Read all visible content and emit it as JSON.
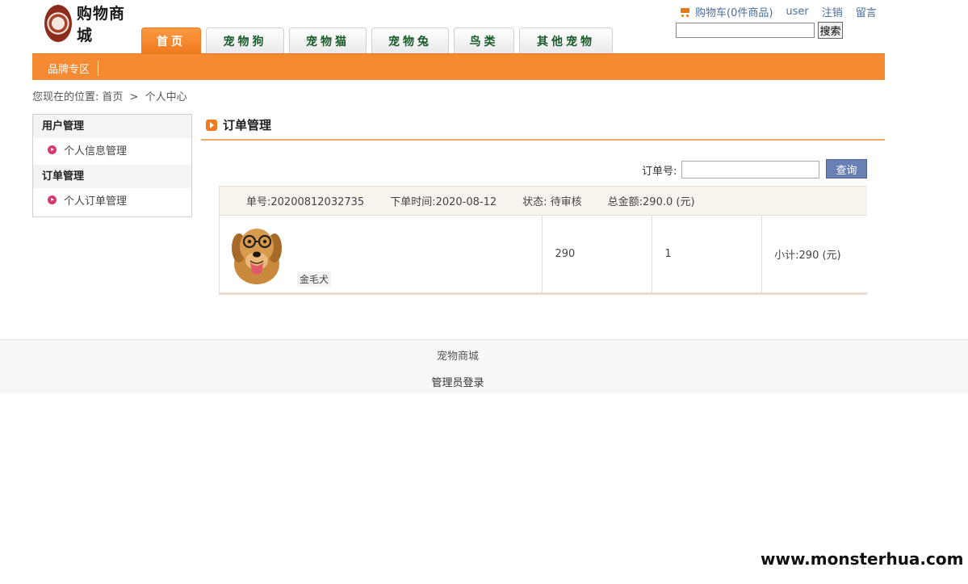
{
  "header": {
    "logo_text": "购物商城",
    "nav_tabs": [
      {
        "label": "首页",
        "active": true
      },
      {
        "label": "宠物狗",
        "active": false
      },
      {
        "label": "宠物猫",
        "active": false
      },
      {
        "label": "宠物兔",
        "active": false
      },
      {
        "label": "鸟类",
        "active": false
      },
      {
        "label": "其他宠物",
        "active": false
      }
    ],
    "cart_label": "购物车(0件商品)",
    "user_label": "user",
    "logout_label": "注销",
    "message_label": "留言",
    "search_value": "",
    "search_button": "搜索"
  },
  "brand_bar": {
    "brand_link": "品牌专区"
  },
  "breadcrumb": {
    "prefix": "您现在的位置:",
    "home": "首页",
    "separator": ">",
    "current": "个人中心"
  },
  "sidebar": {
    "sections": [
      {
        "title": "用户管理",
        "item": "个人信息管理"
      },
      {
        "title": "订单管理",
        "item": "个人订单管理"
      }
    ]
  },
  "main": {
    "title": "订单管理",
    "order_search_label": "订单号:",
    "order_search_value": "",
    "query_button": "查询",
    "order": {
      "order_no": "单号:20200812032735",
      "order_time": "下单时间:2020-08-12",
      "status": "状态: 待审核",
      "total": "总金额:290.0 (元)",
      "product_name": "金毛犬",
      "price": "290",
      "quantity": "1",
      "subtotal": "小计:290 (元)"
    }
  },
  "footer": {
    "site_name": "宠物商城",
    "admin_login": "管理员登录"
  },
  "watermark": "www.monsterhua.com",
  "colors": {
    "accent_orange": "#f68a33",
    "query_button": "#6a7fb3",
    "nav_text": "#1a5a2a",
    "bullet": "#d9386b"
  }
}
